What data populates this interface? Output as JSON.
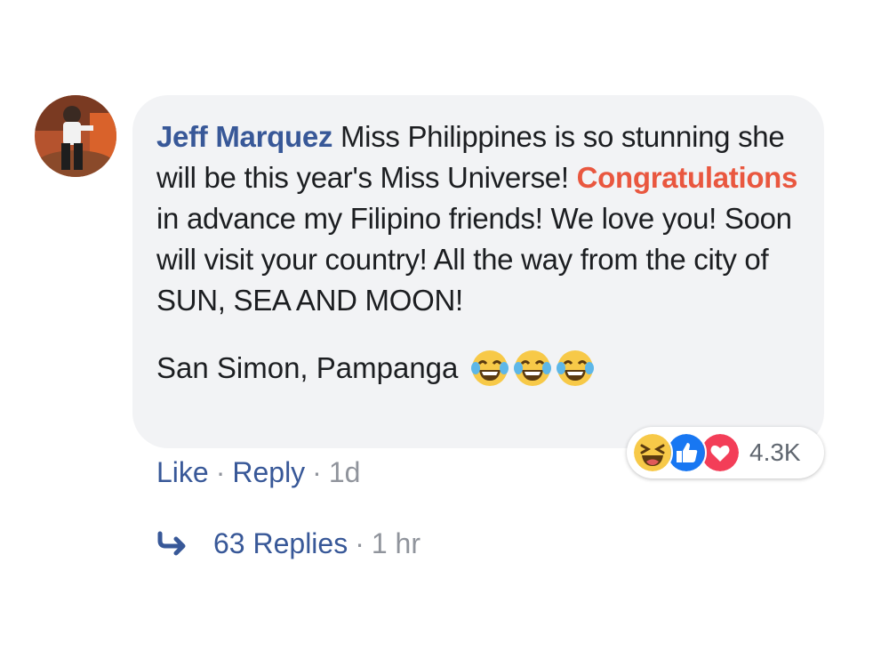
{
  "comment": {
    "author": "Jeff Marquez",
    "text_before": " Miss Philippines is so stunning she will be this year's Miss Universe! ",
    "highlight": "Congratulations",
    "text_after": " in advance my Filipino friends! We love you! Soon will visit your country! All the way from the city of SUN, SEA AND MOON!",
    "location": "San Simon, Pampanga",
    "emoji_icons": [
      "tears-of-joy-icon",
      "tears-of-joy-icon",
      "tears-of-joy-icon"
    ]
  },
  "reactions": {
    "icons": [
      "haha-icon",
      "like-icon",
      "love-icon"
    ],
    "count": "4.3K"
  },
  "actions": {
    "like_label": "Like",
    "separator": "·",
    "reply_label": "Reply",
    "time": "1d"
  },
  "replies": {
    "label": "63 Replies",
    "separator": "·",
    "time": "1 hr"
  },
  "colors": {
    "link": "#385898",
    "highlight": "#e9573f",
    "bubble": "#f2f3f5",
    "like_blue": "#1877f2",
    "love_red": "#f33e58",
    "emoji_yellow": "#f7c948"
  }
}
